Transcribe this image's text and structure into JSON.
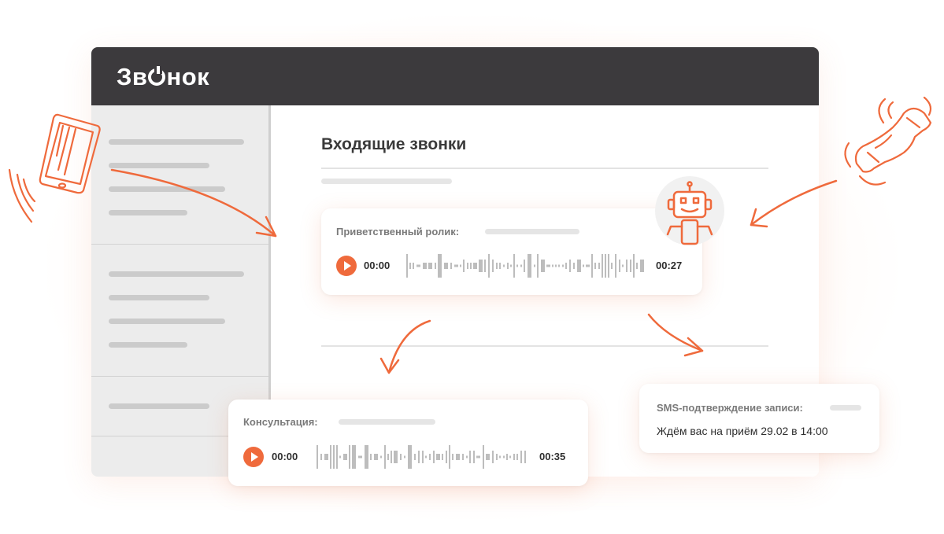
{
  "app": {
    "logo_text": "Звонок"
  },
  "main": {
    "title": "Входящие звонки"
  },
  "cards": {
    "greeting": {
      "label": "Приветственный ролик:",
      "time_start": "00:00",
      "time_end": "00:27"
    },
    "consultation": {
      "label": "Консультация:",
      "time_start": "00:00",
      "time_end": "00:35"
    },
    "sms": {
      "label": "SMS-подтверждение записи:",
      "message": "Ждём вас на приём 29.02 в 14:00"
    }
  },
  "colors": {
    "accent": "#ef6a3c",
    "topbar": "#3c3a3d",
    "sidebar": "#ececec"
  },
  "icons": [
    "smartphone-icon",
    "phone-handset-icon",
    "robot-icon",
    "play-icon",
    "waveform-icon",
    "arrow-icon"
  ]
}
